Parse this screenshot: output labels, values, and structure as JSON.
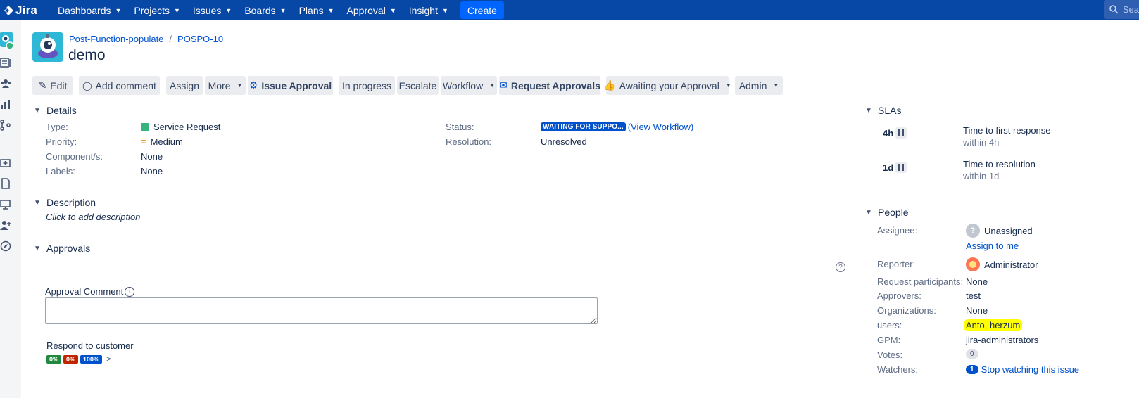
{
  "topnav": {
    "logo_text": "Jira",
    "items": [
      "Dashboards",
      "Projects",
      "Issues",
      "Boards",
      "Plans",
      "Approval",
      "Insight"
    ],
    "create_label": "Create",
    "search_placeholder": "Sea"
  },
  "breadcrumb": {
    "project": "Post-Function-populate",
    "separator": "/",
    "issue_key": "POSPO-10"
  },
  "issue": {
    "title": "demo"
  },
  "toolbar": {
    "edit": "Edit",
    "add_comment": "Add comment",
    "assign": "Assign",
    "more": "More",
    "issue_approval": "Issue Approval",
    "in_progress": "In progress",
    "escalate": "Escalate",
    "workflow": "Workflow",
    "request_approvals": "Request Approvals",
    "awaiting": "Awaiting your Approval",
    "admin": "Admin"
  },
  "details": {
    "heading": "Details",
    "type_label": "Type:",
    "type_value": "Service Request",
    "priority_label": "Priority:",
    "priority_value": "Medium",
    "components_label": "Component/s:",
    "components_value": "None",
    "labels_label": "Labels:",
    "labels_value": "None",
    "status_label": "Status:",
    "status_value": "WAITING FOR SUPPO...",
    "view_workflow": "(View Workflow)",
    "resolution_label": "Resolution:",
    "resolution_value": "Unresolved"
  },
  "description": {
    "heading": "Description",
    "placeholder": "Click to add description"
  },
  "approvals": {
    "heading": "Approvals",
    "comment_label": "Approval Comment",
    "respond_label": "Respond to customer",
    "percentages": [
      {
        "value": "0%",
        "color": "#1f8a3e"
      },
      {
        "value": "0%",
        "color": "#bf2600"
      },
      {
        "value": "100%",
        "color": "#0052cc"
      }
    ]
  },
  "slas": {
    "heading": "SLAs",
    "items": [
      {
        "time": "4h",
        "name": "Time to first response",
        "sub": "within 4h"
      },
      {
        "time": "1d",
        "name": "Time to resolution",
        "sub": "within 1d"
      }
    ]
  },
  "people": {
    "heading": "People",
    "assignee_label": "Assignee:",
    "assignee_value": "Unassigned",
    "assign_to_me": "Assign to me",
    "reporter_label": "Reporter:",
    "reporter_value": "Administrator",
    "participants_label": "Request participants:",
    "participants_value": "None",
    "approvers_label": "Approvers:",
    "approvers_value": "test",
    "organizations_label": "Organizations:",
    "organizations_value": "None",
    "users_label": "users:",
    "users_value": "Anto, herzum",
    "gpm_label": "GPM:",
    "gpm_value": "jira-administrators",
    "votes_label": "Votes:",
    "votes_value": "0",
    "watchers_label": "Watchers:",
    "watchers_count": "1",
    "watchers_action": "Stop watching this issue"
  },
  "colors": {
    "nav_bg": "#0747a6",
    "create_bg": "#0065ff",
    "link": "#0052cc",
    "highlight": "#ffff00"
  }
}
